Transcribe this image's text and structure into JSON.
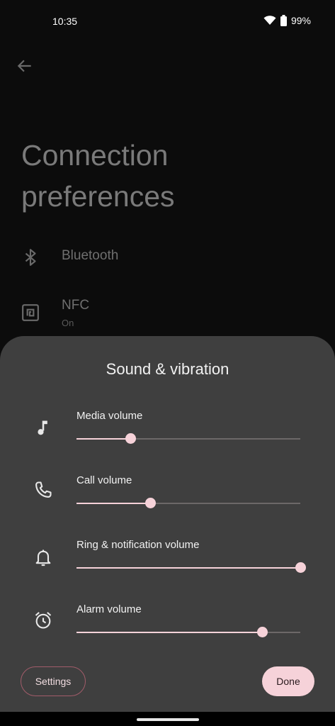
{
  "status_bar": {
    "time": "10:35",
    "battery": "99%"
  },
  "page": {
    "title": "Connection preferences",
    "items": [
      {
        "label": "Bluetooth",
        "icon": "bluetooth-icon"
      },
      {
        "label": "NFC",
        "sub": "On",
        "icon": "nfc-icon"
      }
    ]
  },
  "sheet": {
    "title": "Sound & vibration",
    "volumes": [
      {
        "label": "Media volume",
        "icon": "music-note-icon",
        "level": 0.24
      },
      {
        "label": "Call volume",
        "icon": "phone-icon",
        "level": 0.33
      },
      {
        "label": "Ring & notification volume",
        "icon": "bell-icon",
        "level": 1.0
      },
      {
        "label": "Alarm volume",
        "icon": "alarm-icon",
        "level": 0.83
      }
    ],
    "settings_label": "Settings",
    "done_label": "Done"
  },
  "colors": {
    "accent": "#f6d2d9",
    "sheet_bg": "#3f3f3f",
    "outline": "#a25c6a"
  }
}
